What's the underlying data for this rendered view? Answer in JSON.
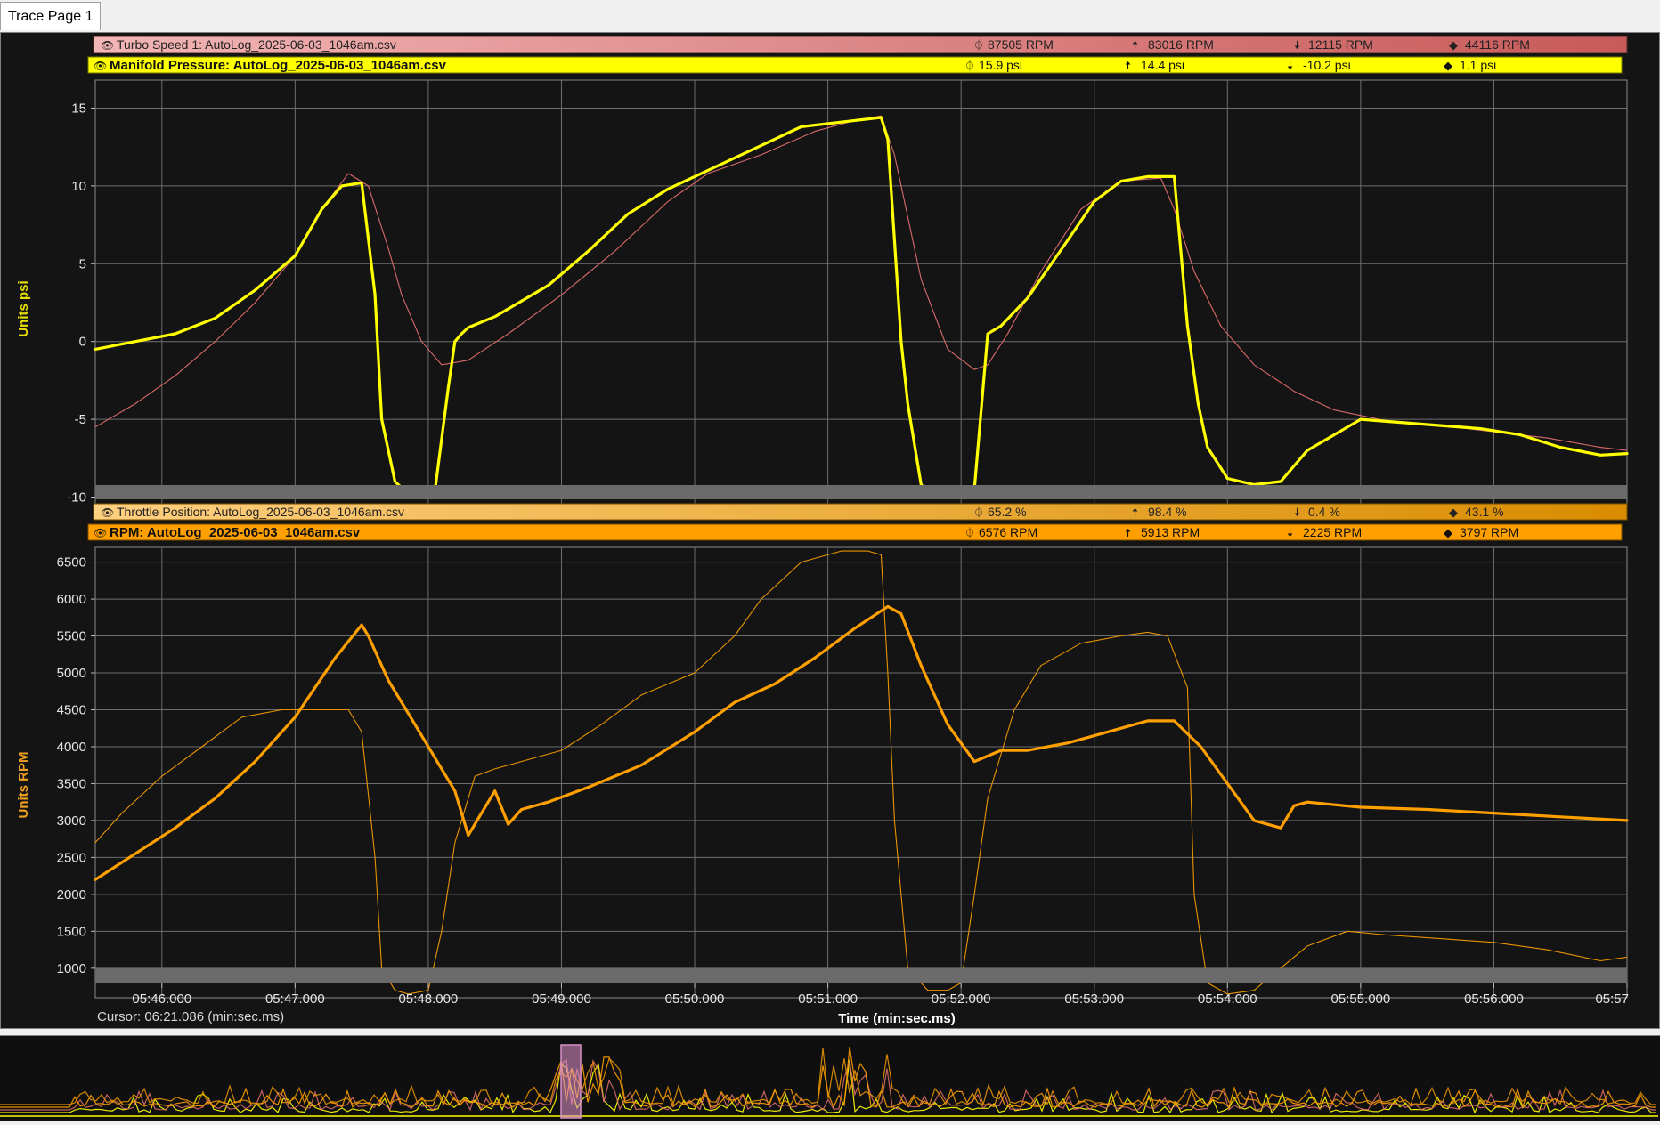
{
  "tab": {
    "label": "Trace Page 1"
  },
  "icons": {
    "visible": "eye-icon",
    "current": "cursor-value-icon",
    "max": "arrow-up-icon",
    "min": "arrow-down-icon",
    "avg": "diamond-icon"
  },
  "panels": [
    {
      "y_axis_label": "Units psi",
      "y_axis_color": "#e8e000",
      "channels": [
        {
          "label": "Turbo Speed 1: AutoLog_2025-06-03_1046am.csv",
          "bold": false,
          "bar_colors": [
            "#f2b5b5",
            "#c85a5a"
          ],
          "current": "87505 RPM",
          "max": "83016 RPM",
          "min": "12115 RPM",
          "avg": "44116 RPM"
        },
        {
          "label": "Manifold Pressure: AutoLog_2025-06-03_1046am.csv",
          "bold": true,
          "bar_colors": [
            "#ffff00",
            "#ffff00"
          ],
          "current": "15.9 psi",
          "max": "14.4 psi",
          "min": "-10.2 psi",
          "avg": "1.1 psi"
        }
      ]
    },
    {
      "y_axis_label": "Units RPM",
      "y_axis_color": "#f0a020",
      "channels": [
        {
          "label": "Throttle Position: AutoLog_2025-06-03_1046am.csv",
          "bold": false,
          "bar_colors": [
            "#ffd080",
            "#d98c00"
          ],
          "current": "65.2 %",
          "max": "98.4 %",
          "min": "0.4 %",
          "avg": "43.1 %"
        },
        {
          "label": "RPM: AutoLog_2025-06-03_1046am.csv",
          "bold": true,
          "bar_colors": [
            "#ffa000",
            "#ffa000"
          ],
          "current": "6576 RPM",
          "max": "5913 RPM",
          "min": "2225 RPM",
          "avg": "3797 RPM"
        }
      ]
    }
  ],
  "x_axis": {
    "label": "Time (min:sec.ms)",
    "ticks": [
      "05:46.000",
      "05:47.000",
      "05:48.000",
      "05:49.000",
      "05:50.000",
      "05:51.000",
      "05:52.000",
      "05:53.000",
      "05:54.000",
      "05:55.000",
      "05:56.000",
      "05:57"
    ],
    "cursor_readout": "Cursor: 06:21.086 (min:sec.ms)"
  },
  "colors": {
    "background": "#141414",
    "grid": "#6e6e6e",
    "manifold_pressure": "#ffff00",
    "turbo_speed": "#d96a6a",
    "rpm": "#ffa000",
    "throttle": "#e89400"
  },
  "chart_data": [
    {
      "type": "line",
      "title": "",
      "xlabel": "Time (min:sec.ms)",
      "ylabel": "Units psi",
      "xlim": [
        345.5,
        357.0
      ],
      "ylim": [
        -11,
        16.8
      ],
      "yticks": [
        15,
        10,
        5,
        0,
        -5,
        -10
      ],
      "grid": true,
      "series": [
        {
          "name": "Manifold Pressure: AutoLog_2025-06-03_1046am.csv",
          "color": "#ffff00",
          "width": 3.2,
          "x": [
            345.5,
            345.8,
            346.1,
            346.4,
            346.7,
            347.0,
            347.2,
            347.35,
            347.5,
            347.6,
            347.65,
            347.75,
            347.85,
            347.95,
            348.05,
            348.15,
            348.2,
            348.25,
            348.3,
            348.5,
            348.7,
            348.9,
            349.2,
            349.5,
            349.8,
            350.0,
            350.3,
            350.6,
            350.8,
            351.1,
            351.4,
            351.45,
            351.55,
            351.6,
            351.7,
            351.8,
            351.95,
            352.1,
            352.2,
            352.3,
            352.5,
            352.8,
            353.0,
            353.2,
            353.4,
            353.6,
            353.7,
            353.78,
            353.85,
            354.0,
            354.2,
            354.4,
            354.6,
            354.8,
            355.0,
            355.3,
            355.6,
            355.9,
            356.2,
            356.5,
            356.8,
            357.0
          ],
          "y": [
            -0.5,
            0.0,
            0.5,
            1.5,
            3.3,
            5.5,
            8.5,
            10.0,
            10.2,
            3.0,
            -5.0,
            -9.0,
            -9.8,
            -9.8,
            -9.6,
            -3.0,
            0.0,
            0.5,
            0.9,
            1.6,
            2.6,
            3.6,
            5.8,
            8.2,
            9.8,
            10.6,
            11.8,
            13.0,
            13.8,
            14.1,
            14.4,
            13.0,
            0.0,
            -4.0,
            -9.2,
            -10.0,
            -10.0,
            -9.5,
            0.5,
            1.0,
            2.8,
            6.5,
            9.0,
            10.3,
            10.6,
            10.6,
            1.0,
            -4.0,
            -6.8,
            -8.8,
            -9.2,
            -9.0,
            -7.0,
            -6.0,
            -5.0,
            -5.2,
            -5.4,
            -5.6,
            -6.0,
            -6.8,
            -7.3,
            -7.2
          ]
        },
        {
          "name": "Turbo Speed 1: AutoLog_2025-06-03_1046am.csv",
          "color": "#d96a6a",
          "width": 1.1,
          "x": [
            345.5,
            345.8,
            346.1,
            346.4,
            346.7,
            347.0,
            347.2,
            347.4,
            347.55,
            347.7,
            347.8,
            347.95,
            348.1,
            348.3,
            348.6,
            349.0,
            349.4,
            349.8,
            350.1,
            350.5,
            350.9,
            351.2,
            351.4,
            351.5,
            351.7,
            351.9,
            352.1,
            352.2,
            352.35,
            352.6,
            352.9,
            353.2,
            353.5,
            353.6,
            353.75,
            353.95,
            354.2,
            354.5,
            354.8,
            355.2,
            355.6,
            356.0,
            356.4,
            356.8,
            357.0
          ],
          "y": [
            -5.5,
            -4.0,
            -2.2,
            0.0,
            2.5,
            5.5,
            8.5,
            10.8,
            10.0,
            6.0,
            3.0,
            0.0,
            -1.5,
            -1.2,
            0.5,
            3.0,
            5.8,
            9.0,
            10.8,
            12.0,
            13.5,
            14.2,
            14.5,
            12.0,
            4.0,
            -0.5,
            -1.8,
            -1.5,
            0.5,
            4.5,
            8.5,
            10.3,
            10.5,
            8.5,
            4.5,
            1.0,
            -1.5,
            -3.2,
            -4.4,
            -5.1,
            -5.4,
            -5.8,
            -6.2,
            -6.8,
            -7.0
          ]
        }
      ]
    },
    {
      "type": "line",
      "title": "",
      "xlabel": "Time (min:sec.ms)",
      "ylabel": "Units RPM",
      "xlim": [
        345.5,
        357.0
      ],
      "ylim": [
        600,
        6700
      ],
      "yticks": [
        6500,
        6000,
        5500,
        5000,
        4500,
        4000,
        3500,
        3000,
        2500,
        2000,
        1500,
        1000
      ],
      "grid": true,
      "series": [
        {
          "name": "RPM: AutoLog_2025-06-03_1046am.csv",
          "color": "#ffa000",
          "width": 3.2,
          "x": [
            345.5,
            345.8,
            346.1,
            346.4,
            346.7,
            347.0,
            347.3,
            347.5,
            347.55,
            347.7,
            347.9,
            348.1,
            348.2,
            348.3,
            348.4,
            348.5,
            348.6,
            348.7,
            348.9,
            349.2,
            349.6,
            350.0,
            350.3,
            350.6,
            350.9,
            351.2,
            351.45,
            351.55,
            351.7,
            351.9,
            352.1,
            352.3,
            352.5,
            352.8,
            353.1,
            353.4,
            353.6,
            353.8,
            354.0,
            354.2,
            354.4,
            354.5,
            354.6,
            355.0,
            355.5,
            356.0,
            356.5,
            357.0
          ],
          "y": [
            2200,
            2550,
            2900,
            3300,
            3800,
            4400,
            5200,
            5650,
            5500,
            4900,
            4300,
            3700,
            3400,
            2800,
            3100,
            3400,
            2950,
            3150,
            3250,
            3450,
            3750,
            4200,
            4600,
            4850,
            5200,
            5600,
            5900,
            5800,
            5100,
            4300,
            3800,
            3950,
            3950,
            4050,
            4200,
            4350,
            4350,
            4000,
            3500,
            3000,
            2900,
            3200,
            3250,
            3180,
            3150,
            3100,
            3050,
            3000
          ]
        },
        {
          "name": "Throttle Position: AutoLog_2025-06-03_1046am.csv",
          "color": "#e89400",
          "width": 1.1,
          "x": [
            345.5,
            345.7,
            346.0,
            346.3,
            346.6,
            346.9,
            347.2,
            347.4,
            347.5,
            347.6,
            347.65,
            347.75,
            347.85,
            348.0,
            348.1,
            348.2,
            348.35,
            348.5,
            348.8,
            349.0,
            349.3,
            349.6,
            350.0,
            350.3,
            350.5,
            350.8,
            351.1,
            351.3,
            351.4,
            351.45,
            351.5,
            351.6,
            351.75,
            351.9,
            352.0,
            352.1,
            352.2,
            352.4,
            352.6,
            352.9,
            353.2,
            353.4,
            353.55,
            353.7,
            353.75,
            353.85,
            354.0,
            354.2,
            354.4,
            354.6,
            354.9,
            355.2,
            355.6,
            356.0,
            356.4,
            356.8,
            357.0
          ],
          "y": [
            2700,
            3100,
            3600,
            4000,
            4400,
            4500,
            4500,
            4500,
            4200,
            2500,
            1000,
            700,
            650,
            700,
            1500,
            2700,
            3600,
            3700,
            3850,
            3950,
            4300,
            4700,
            5000,
            5500,
            6000,
            6500,
            6650,
            6650,
            6600,
            5000,
            3000,
            1000,
            700,
            700,
            800,
            2000,
            3300,
            4500,
            5100,
            5400,
            5500,
            5550,
            5500,
            4800,
            2000,
            800,
            650,
            700,
            1000,
            1300,
            1500,
            1450,
            1400,
            1350,
            1250,
            1100,
            1150
          ]
        }
      ]
    }
  ]
}
